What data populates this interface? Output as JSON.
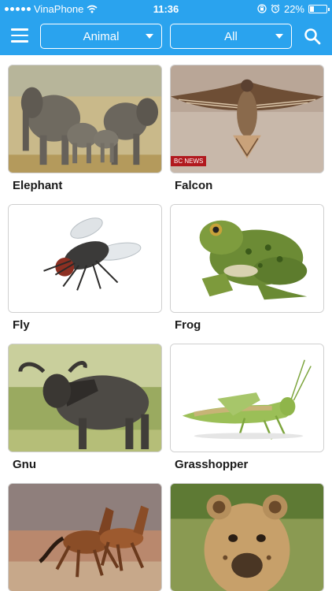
{
  "status": {
    "carrier": "VinaPhone",
    "time": "11:36",
    "battery": "22%",
    "battery_level": 0.22
  },
  "toolbar": {
    "menu_icon": "menu-icon",
    "category": "Animal",
    "filter": "All",
    "search_icon": "search-icon"
  },
  "animals": [
    {
      "name": "Elephant"
    },
    {
      "name": "Falcon",
      "badge": "BC NEWS"
    },
    {
      "name": "Fly"
    },
    {
      "name": "Frog"
    },
    {
      "name": "Gnu"
    },
    {
      "name": "Grasshopper"
    },
    {
      "name": ""
    },
    {
      "name": ""
    }
  ],
  "colors": {
    "accent": "#2aa3ee"
  }
}
